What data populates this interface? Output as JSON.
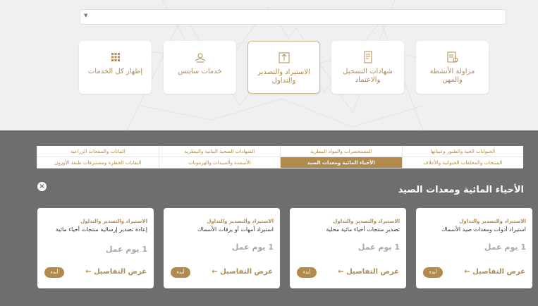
{
  "search": {
    "selected_value": ""
  },
  "service_cards": [
    {
      "label": "مزاولة الأنشطة والمهن",
      "icon": "activities-icon"
    },
    {
      "label": "شهادات التسجيل والاعتماد",
      "icon": "certificate-icon"
    },
    {
      "label": "الاستيراد والتصدير والتداول",
      "icon": "import-export-icon"
    },
    {
      "label": "خدمات سايتس",
      "icon": "cites-icon"
    },
    {
      "label": "إظهار كل الخدمات",
      "icon": "grid-icon"
    }
  ],
  "tabs": {
    "row1": [
      "الحيوانات الحية والطيور وعيناتها",
      "المستحضرات والمواد البيطرية",
      "الشهادات الصحية النباتية والبيطرية",
      "النباتات والمنتجات الزراعية"
    ],
    "row2": [
      "المنتجات والمخلفات الحيوانية والأعلاف",
      "الأحياء المائية ومعدات الصيد",
      "الأسمدة والمبيدات والهرمونات",
      "النفايات الخطرة ومستنزفات طبقة الأوزون"
    ],
    "active": "الأحياء المائية ومعدات الصيد"
  },
  "section": {
    "title": "الأحياء المائية ومعدات الصيد",
    "close_label": "×"
  },
  "cards": [
    {
      "category": "الاستيراد والتصدير والتداول",
      "title": "استيراد أدوات ومعدات صيد الأسماك",
      "duration": "1 يوم عمل",
      "start_label": "أبدء",
      "details_label": "عرض التفاصيل ←"
    },
    {
      "category": "الاستيراد والتصدير والتداول",
      "title": "تصدير منتجات أحياء مائية محلية",
      "duration": "1 يوم عمل",
      "start_label": "أبدء",
      "details_label": "عرض التفاصيل ←"
    },
    {
      "category": "الاستيراد والتصدير والتداول",
      "title": "استيراد أمهات أو يرقات الأسماك",
      "duration": "1 يوم عمل",
      "start_label": "أبدء",
      "details_label": "عرض التفاصيل ←"
    },
    {
      "category": "الاستيراد والتصدير والتداول",
      "title": "إعادة تصدير إرسالية منتجات أحياء مائية",
      "duration": "1 يوم عمل",
      "start_label": "أبدء",
      "details_label": "عرض التفاصيل ←"
    }
  ],
  "colors": {
    "accent": "#b28a4e",
    "bottom_bg": "#6e6e6e"
  }
}
